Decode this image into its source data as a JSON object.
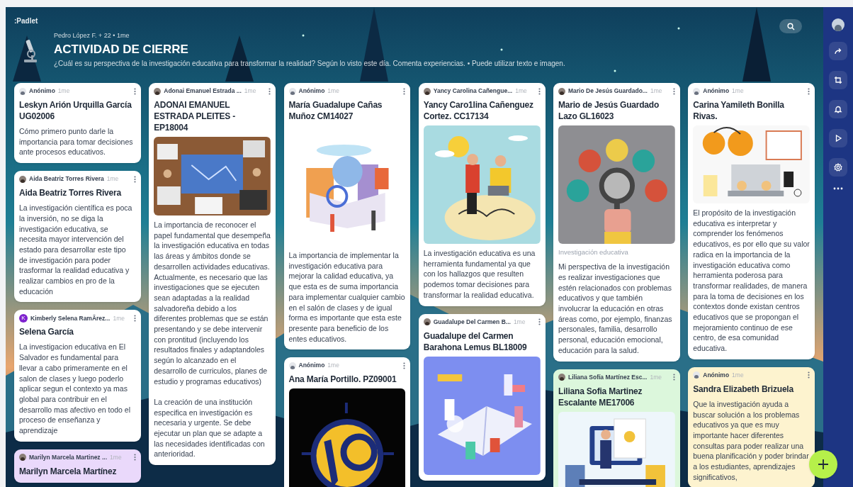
{
  "board": {
    "logo": ":Padlet",
    "byline": "Pedro López F. + 22 • 1me",
    "title": "ACTIVIDAD DE CIERRE",
    "description": "¿Cuál es su perspectiva de la investigación educativa para transformar la realidad? Según lo visto este día. Comenta experiencias. • Puede utilizar texto e imagen."
  },
  "columns": [
    [
      {
        "avatar": {
          "kind": "anon"
        },
        "author": "Anónimo",
        "time": "1me",
        "title": "Leskyn Arión Urquilla García UG02006",
        "body": "Cómo primero punto darle la importancia para tomar decisiones ante procesos educativos.",
        "color": "#ffffff"
      },
      {
        "author": "Aida Beatriz Torres Rivera",
        "time": "1me",
        "title": "Aida Beatriz Torres Rivera",
        "body": "La investigación científica es poca la inversión, no se diga la investigación educativa, se necesita mayor intervención del estado para desarrollar este tipo de investigación para poder trasformar la realidad educativa y realizar cambios en pro de la educación",
        "color": "#ffffff"
      },
      {
        "avatar": {
          "kind": "initial",
          "letter": "K"
        },
        "author": "Kimberly Selena RamÃrez...",
        "time": "1me",
        "title": "Selena García",
        "body": "La investigacion educativa en El Salvador es fundamental para llevar a cabo primeramente en el salon de clases y luego poderlo aplicar segun el contexto ya mas global para contribuir en el desarrollo mas afectivo en todo el proceso de enseñanza y aprendizaje",
        "color": "#ffffff"
      },
      {
        "author": "Marilyn Marcela Martinez ...",
        "time": "1me",
        "title": "Marilyn Marcela Martínez",
        "color": "#ead9fb"
      }
    ],
    [
      {
        "author": "Adonai Emanuel Estrada ...",
        "time": "1me",
        "title": "ADONAI EMANUEL ESTRADA PLEITES - EP18004",
        "body": "La importancia de reconocer el papel fundamental que desempeña la investigación educativa en todas las áreas y ámbitos  donde se desarrollen actividades educativas. Actualmente, es necesario que las investigaciones que se ejecuten sean adaptadas a la realidad salvadoreña debido a los diferentes problemas que se están presentando y se debe intervenir con prontitud (incluyendo los resultados finales y adaptandoles según lo alcanzado en el desarrollo de curriculos, planes de estudio y programas educativos)\n\nLa creación de una institución especifica en investigación es necesaria y urgente. Se debe ejecutar un plan que se adapte a las necesidades identificadas con anterioridad.",
        "color": "#ffffff"
      }
    ],
    [
      {
        "avatar": {
          "kind": "anon"
        },
        "author": "Anónimo",
        "time": "1me",
        "title": "María Guadalupe Cañas Muñoz CM14027",
        "body": "La importancia de implementar la investigación educativa para mejorar la calidad educativa, ya que esta es de suma importancia para implementar cualquier cambio en el salón de clases y de igual forma es importante que esta este presente para beneficio de los entes educativos.",
        "color": "#ffffff"
      },
      {
        "avatar": {
          "kind": "anon"
        },
        "author": "Anónimo",
        "time": "1me",
        "title": "Ana María Portillo. PZ09001",
        "color": "#ffffff"
      }
    ],
    [
      {
        "author": "Yancy Carolina Cañengue...",
        "time": "1me",
        "title": "Yancy Caro1lina Cañenguez Cortez. CC17134",
        "body": "La investigación educativa es una herramienta fundamental ya que con los hallazgos que resulten podemos tomar decisiones para transformar la realidad educativa.",
        "color": "#ffffff"
      },
      {
        "author": "Guadalupe Del Carmen B...",
        "time": "1me",
        "title": "Guadalupe del Carmen Barahona Lemus BL18009",
        "color": "#ffffff"
      }
    ],
    [
      {
        "author": "Mario De Jesús Guardado...",
        "time": "1me",
        "title": "Mario de Jesús Guardado Lazo GL16023",
        "caption": "Investigación educativa",
        "body": "Mi perspectiva de la investigación es realizar investigaciones que estén relacionados con problemas educativos y que también involucrar la educación en otras áreas como, por ejemplo, finanzas personales, familia, desarrollo personal, educación emocional, educación para la salud.",
        "color": "#ffffff"
      },
      {
        "author": "Liliana Sofía Martínez Esc...",
        "time": "1me",
        "title": "Liliana Sofia Martinez Escalante ME17006",
        "color": "#dcf7dc"
      }
    ],
    [
      {
        "avatar": {
          "kind": "anon"
        },
        "author": "Anónimo",
        "time": "1me",
        "title": "Carina Yamileth Bonilla Rivas.",
        "body": "El propósito de la investigación educativa es interpretar y comprender los fenómenos educativos, es por ello que su valor radica en la importancia de la investigación educativa como herramienta poderosa para transformar realidades, de manera para la toma de decisiones en los contextos donde existan centros educativos que se propongan el mejoramiento continuo de ese centro, de esa comunidad educativa.",
        "color": "#ffffff"
      },
      {
        "avatar": {
          "kind": "anon"
        },
        "author": "Anónimo",
        "time": "1me",
        "title": "Sandra Elizabeth Brizuela",
        "body": "Que la investigación ayuda a buscar solución a los problemas educativos ya que es muy importante hacer diferentes consultas para poder realizar una buena planificación y poder brindar a los estudiantes, aprendizajes significativos,",
        "color": "#fdf3cf"
      }
    ]
  ]
}
